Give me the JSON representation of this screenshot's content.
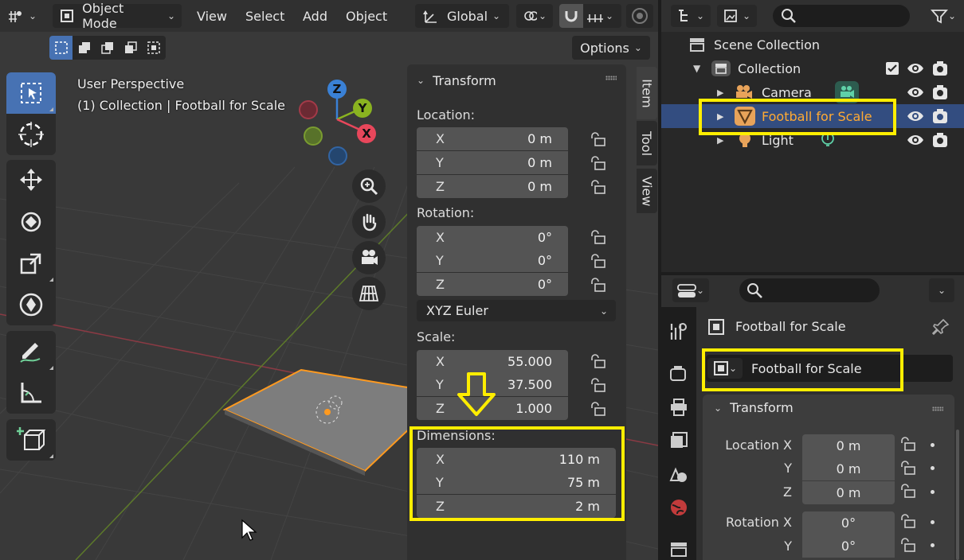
{
  "header": {
    "mode": "Object Mode",
    "menus": [
      "View",
      "Select",
      "Add",
      "Object"
    ],
    "transform_orientation": "Global",
    "options": "Options"
  },
  "viewport": {
    "view_name": "User Perspective",
    "context": "(1) Collection | Football for Scale",
    "gizmo": {
      "z": "Z",
      "y": "Y",
      "x": "X"
    }
  },
  "npanel": {
    "section_title": "Transform",
    "location_label": "Location:",
    "location": [
      {
        "axis": "X",
        "value": "0 m"
      },
      {
        "axis": "Y",
        "value": "0 m"
      },
      {
        "axis": "Z",
        "value": "0 m"
      }
    ],
    "rotation_label": "Rotation:",
    "rotation": [
      {
        "axis": "X",
        "value": "0°"
      },
      {
        "axis": "Y",
        "value": "0°"
      },
      {
        "axis": "Z",
        "value": "0°"
      }
    ],
    "rotation_mode": "XYZ Euler",
    "scale_label": "Scale:",
    "scale": [
      {
        "axis": "X",
        "value": "55.000"
      },
      {
        "axis": "Y",
        "value": "37.500"
      },
      {
        "axis": "Z",
        "value": "1.000"
      }
    ],
    "dimensions_label": "Dimensions:",
    "dimensions": [
      {
        "axis": "X",
        "value": "110 m"
      },
      {
        "axis": "Y",
        "value": "75 m"
      },
      {
        "axis": "Z",
        "value": "2 m"
      }
    ],
    "tabs": [
      "Item",
      "Tool",
      "View"
    ]
  },
  "outliner": {
    "scene_collection": "Scene Collection",
    "collection": "Collection",
    "items": [
      "Camera",
      "Football for Scale",
      "Light"
    ]
  },
  "properties": {
    "object_name": "Football for Scale",
    "name_field": "Football for Scale",
    "section_title": "Transform",
    "location_label": "Location X",
    "location": [
      "0 m",
      "0 m",
      "0 m"
    ],
    "axis_y": "Y",
    "axis_z": "Z",
    "rotation_label": "Rotation X",
    "rotation": [
      "0°",
      "0°"
    ]
  },
  "colors": {
    "highlight": "#ffee00",
    "selection_blue": "#4772b3",
    "active_orange": "#ffaa33",
    "x_axis": "#e8475b",
    "y_axis": "#8ab320",
    "z_axis": "#3a81d6"
  }
}
